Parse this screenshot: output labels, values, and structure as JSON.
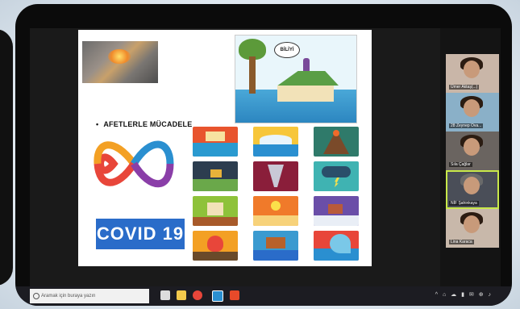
{
  "slide": {
    "bullet_title": "AFETLERLE MÜCADELE",
    "bubble_text": "BİLİYİ",
    "covid_label": "COVID 19"
  },
  "participants": [
    {
      "name": "Ümer Aktaş(...)",
      "active": false
    },
    {
      "name": "28 Zeynep Ova...",
      "active": false
    },
    {
      "name": "Sıla Çağlar",
      "active": false
    },
    {
      "name": "NİF Şahinkaya",
      "active": true
    },
    {
      "name": "Lina Karaca",
      "active": false
    }
  ],
  "taskbar": {
    "search_placeholder": "Aramak için buraya yazın",
    "tray_text": "^ ⌂ ☁ ▮ ✉ ⊕ ♪"
  },
  "colors": {
    "covid_bg": "#2a6cc9",
    "active_border": "#c8e84a"
  },
  "icons": [
    "flood-icon",
    "tsunami-icon",
    "volcano-icon",
    "landslide-icon",
    "tornado-icon",
    "storm-icon",
    "earthquake-house-icon",
    "drought-icon",
    "avalanche-icon",
    "wildfire-icon",
    "sinkhole-icon",
    "wave-icon"
  ]
}
